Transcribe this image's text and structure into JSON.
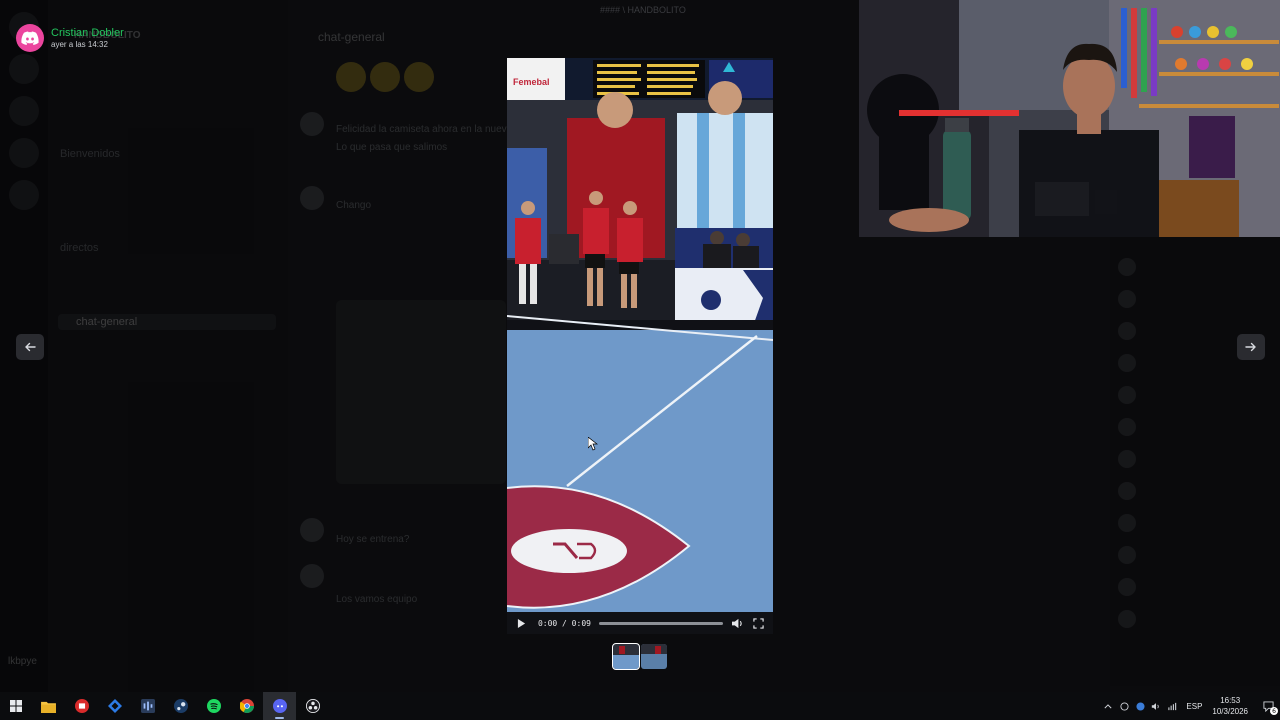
{
  "background_app": {
    "server_name": "HANDBOLITO",
    "window_title": "#### \\ HANDBOLITO",
    "channel_header": "chat-general",
    "channels": [
      {
        "label": "Bienvenidos"
      },
      {
        "label": "directos"
      },
      {
        "label": "chat-general",
        "active": true
      }
    ],
    "messages": [
      {
        "text": "Felicidad la camiseta ahora en la nueva"
      },
      {
        "text": "Lo que pasa que salimos"
      },
      {
        "text": "Chango"
      },
      {
        "text": "Hoy se entrena?"
      },
      {
        "text": "Los vamos equipo"
      }
    ],
    "user": "lkbpye"
  },
  "viewer": {
    "author": "Cristian Dobler",
    "timestamp": "ayer a las 14:32",
    "accent_color": "#eb459e",
    "name_color": "#23c55e"
  },
  "video": {
    "time_display": "0:00 / 0:09",
    "progress": 0.0,
    "scoreboard_brand": "Femebal",
    "court_logo": "LG",
    "shot_clock": "22",
    "play_icon": "play-icon",
    "volume_icon": "volume-icon",
    "fullscreen_icon": "fullscreen-icon"
  },
  "navigation": {
    "prev_icon": "arrow-left-icon",
    "next_icon": "arrow-right-icon"
  },
  "taskbar": {
    "apps": [
      {
        "name": "file-explorer-icon"
      },
      {
        "name": "app-red-icon"
      },
      {
        "name": "app-diamond-icon"
      },
      {
        "name": "audio-app-icon"
      },
      {
        "name": "steam-icon"
      },
      {
        "name": "spotify-icon"
      },
      {
        "name": "chrome-icon"
      },
      {
        "name": "discord-icon",
        "active": true
      },
      {
        "name": "obs-icon"
      }
    ],
    "language": "ESP",
    "time": "16:53",
    "date": "10/3/2026",
    "notification_count": "6"
  }
}
